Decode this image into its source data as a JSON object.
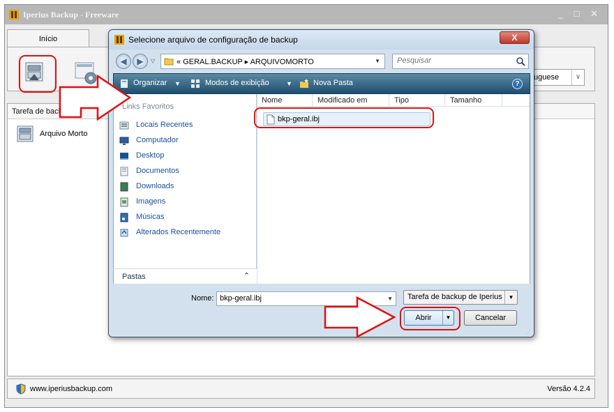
{
  "app": {
    "title": "Iperius Backup - Freeware",
    "window_controls": "_ □ ✕",
    "tab_label": "Início",
    "language_value": "uguese",
    "panel_header": "Tarefa de backup",
    "task_label": "Arquivo Morto",
    "status_url": "www.iperiusbackup.com",
    "version": "Versão 4.2.4"
  },
  "dialog": {
    "title": "Selecione arquivo de configuração de backup",
    "close_label": "X",
    "breadcrumb": "«  GERAL.BACKUP  ▸  ARQUIVOMORTO",
    "search_placeholder": "Pesquisar",
    "toolbar": {
      "organize": "Organizar",
      "views": "Modos de exibição",
      "new_folder": "Nova Pasta"
    },
    "nav": {
      "section": "Links Favoritos",
      "items": [
        {
          "label": "Locais Recentes",
          "icon": "recent-places-icon"
        },
        {
          "label": "Computador",
          "icon": "computer-icon"
        },
        {
          "label": "Desktop",
          "icon": "desktop-icon"
        },
        {
          "label": "Documentos",
          "icon": "documents-icon"
        },
        {
          "label": "Downloads",
          "icon": "downloads-icon"
        },
        {
          "label": "Imagens",
          "icon": "pictures-icon"
        },
        {
          "label": "Músicas",
          "icon": "music-icon"
        },
        {
          "label": "Alterados Recentemente",
          "icon": "recently-changed-icon"
        }
      ],
      "folders_label": "Pastas"
    },
    "columns": [
      "Nome",
      "Modificado em",
      "Tipo",
      "Tamanho"
    ],
    "files": [
      {
        "name": "bkp-geral.ibj"
      }
    ],
    "name_label": "Nome:",
    "name_value": "bkp-geral.ibj",
    "type_value": "Tarefa de backup de Iperius",
    "open_label": "Abrir",
    "cancel_label": "Cancelar"
  },
  "colors": {
    "annotation": "#e01010",
    "toolbar": "#2a5a7a",
    "link": "#1a4f9b"
  }
}
